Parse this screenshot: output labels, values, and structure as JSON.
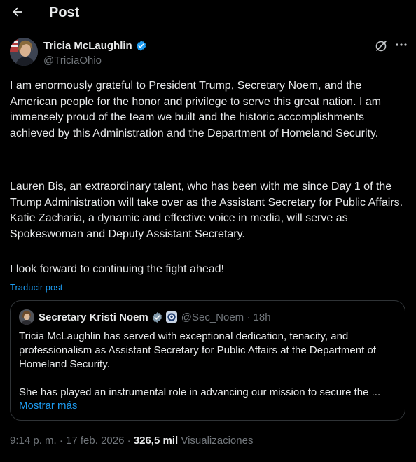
{
  "header": {
    "title": "Post",
    "back_icon": "arrow-left-icon"
  },
  "author": {
    "name": "Tricia McLaughlin",
    "handle": "@TriciaOhio",
    "verified_color": "#1d9bf0"
  },
  "post": {
    "paragraphs": [
      "I am enormously grateful to President Trump, Secretary Noem, and the American people for the honor and privilege to serve this great nation. I am immensely proud of the team we built and the historic accomplishments achieved by this Administration and the Department of Homeland Security.",
      "Lauren Bis, an extraordinary talent, who has been with me since Day 1 of the Trump Administration will take over as the Assistant Secretary for Public Affairs. Katie Zacharia, a dynamic and effective voice in media, will serve as Spokeswoman and Deputy Assistant Secretary.",
      "I look forward to continuing the fight ahead!"
    ],
    "translate_label": "Traducir post"
  },
  "quote": {
    "name": "Secretary Kristi Noem",
    "handle_time": "@Sec_Noem · 18h",
    "paragraphs": [
      "Tricia McLaughlin has served with exceptional dedication, tenacity, and professionalism as Assistant Secretary for Public Affairs at the Department of Homeland Security.",
      "She has played an instrumental role in advancing our mission to secure the ..."
    ],
    "show_more_label": "Mostrar más",
    "badge_color": "#829aab"
  },
  "meta": {
    "time_date": "9:14 p. m. · 17 feb. 2026 · ",
    "views_count": "326,5 mil",
    "views_label": " Visualizaciones"
  },
  "colors": {
    "background": "#000000",
    "text": "#e7e9ea",
    "secondary": "#71767b",
    "accent": "#1d9bf0",
    "border": "#2f3336"
  }
}
